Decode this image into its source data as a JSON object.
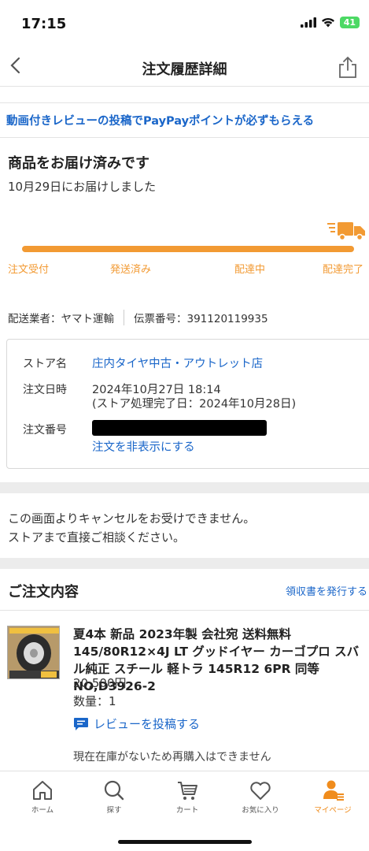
{
  "status": {
    "time": "17:15",
    "battery": "41"
  },
  "nav": {
    "title": "注文履歴詳細"
  },
  "promo": {
    "text": "動画付きレビューの投稿でPayPayポイントが必ずもらえる"
  },
  "delivery": {
    "title": "商品をお届け済みです",
    "date": "10月29日にお届けしました",
    "progress": 1.0,
    "steps": [
      "注文受付",
      "発送済み",
      "配達中",
      "配達完了"
    ],
    "carrier": "配送業者：ヤマト運輸",
    "tracking": "伝票番号：391120119935"
  },
  "store_info": {
    "store_label": "ストア名",
    "store_name": "庄内タイヤ中古・アウトレット店",
    "date_label": "注文日時",
    "order_date": "2024年10月27日 18:14",
    "processed_date": "(ストア処理完了日：2024年10月28日)",
    "order_no_label": "注文番号",
    "hide_link": "注文を非表示にする"
  },
  "cancel_note": {
    "line1": "この画面よりキャンセルをお受けできません。",
    "line2": "ストアまで直接ご相談ください。"
  },
  "order": {
    "title": "ご注文内容",
    "receipt_link": "領収書を発行する",
    "product": {
      "name": "夏4本 新品 2023年製 会社宛 送料無料 145/80R12×4J LT グッドイヤー カーゴプロ スバル純正 スチール 軽トラ 145R12 6PR 同等 NO,D3926-2",
      "price": "20,500円",
      "quantity": "数量：1",
      "review_link": "レビューを投稿する",
      "stock_note": "現在在庫がないため再購入はできません"
    }
  },
  "tabs": [
    {
      "label": "ホーム",
      "icon": "home-icon"
    },
    {
      "label": "探す",
      "icon": "search-icon"
    },
    {
      "label": "カート",
      "icon": "cart-icon"
    },
    {
      "label": "お気に入り",
      "icon": "heart-icon"
    },
    {
      "label": "マイページ",
      "icon": "user-icon",
      "active": true
    }
  ],
  "colors": {
    "accent": "#f29a33",
    "link": "#1a66c9",
    "active_tab": "#f08c1c"
  }
}
